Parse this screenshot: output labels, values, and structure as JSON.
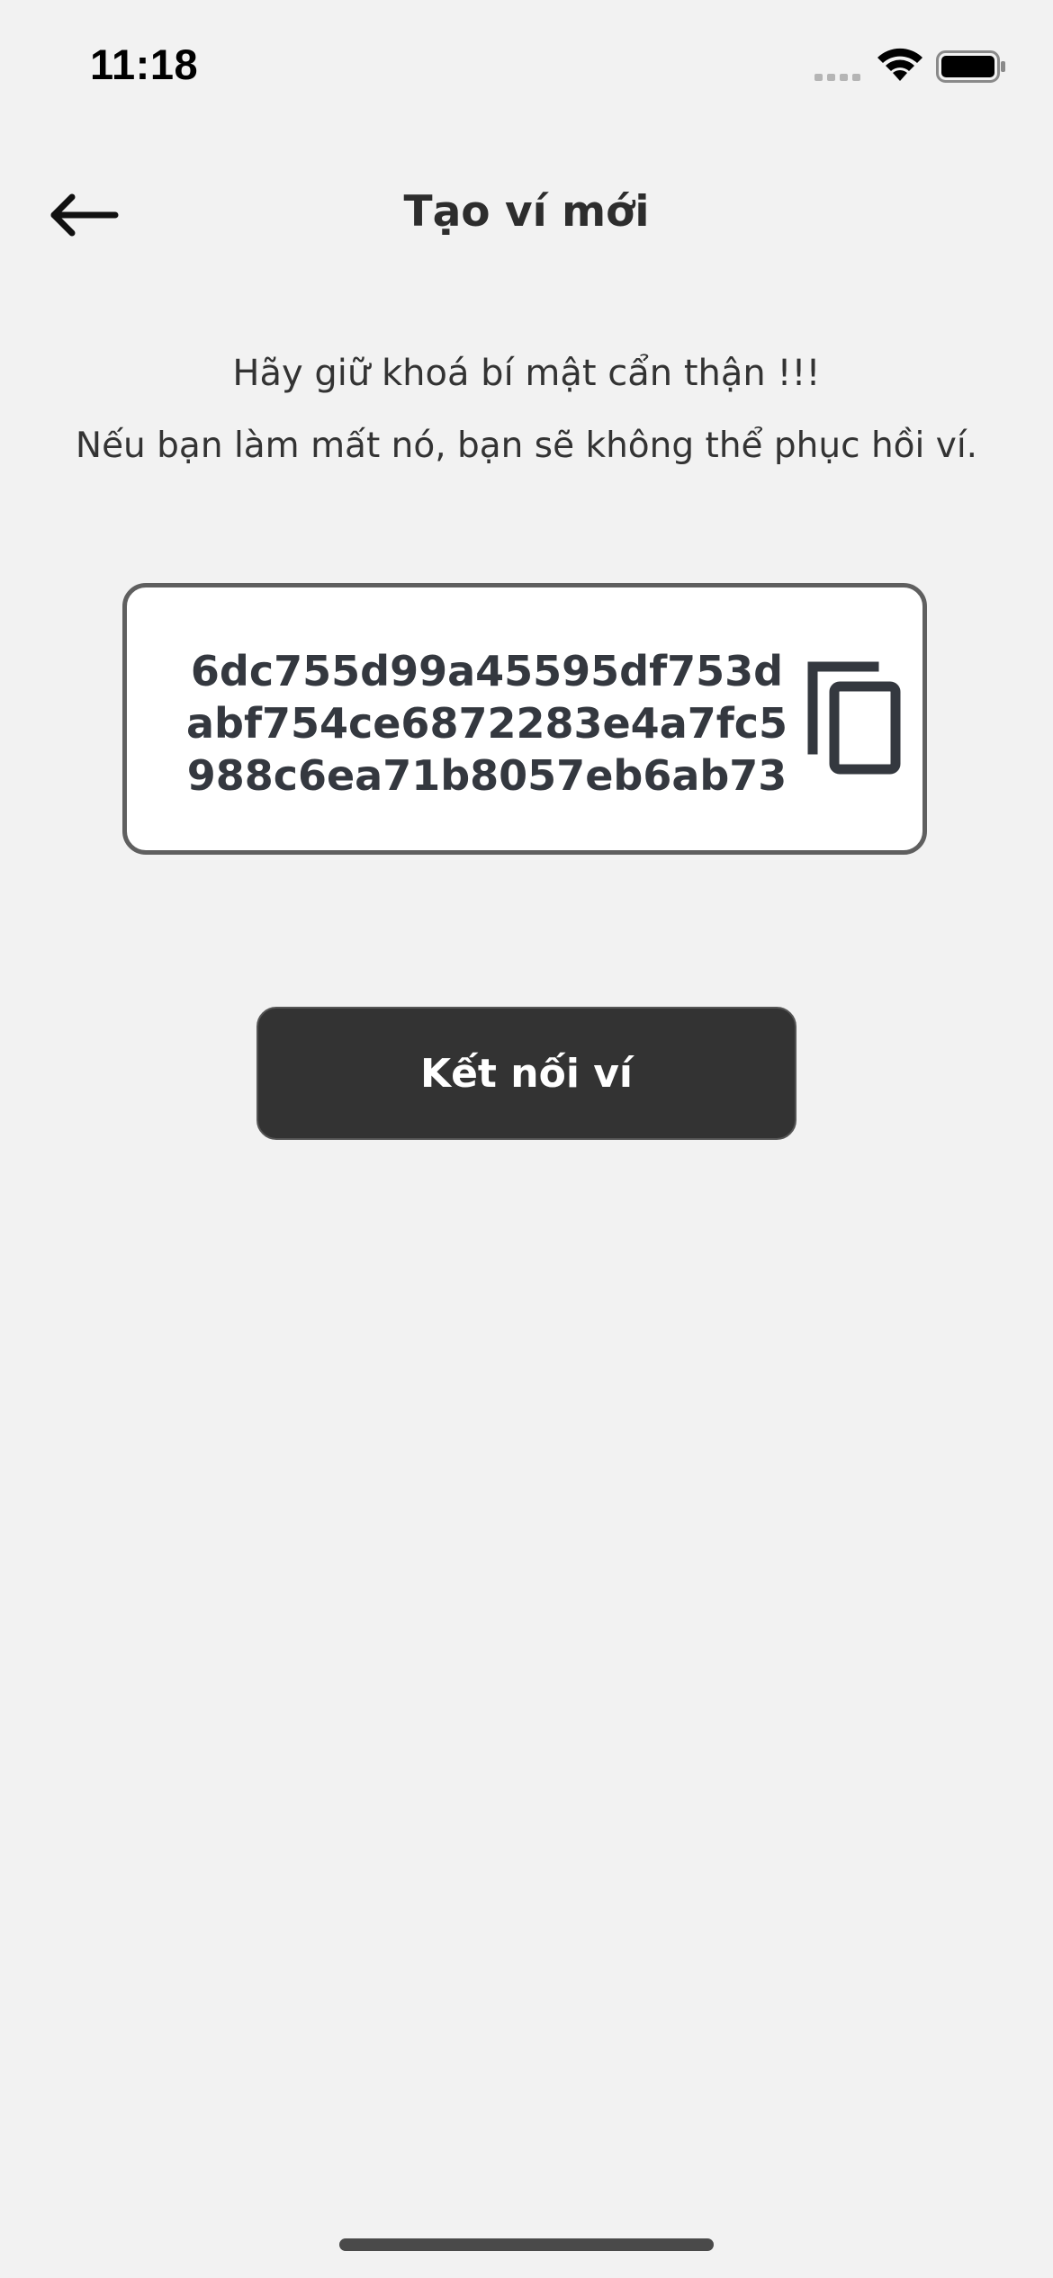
{
  "status_bar": {
    "time": "11:18"
  },
  "header": {
    "title": "Tạo ví mới",
    "back_icon": "arrow-left-icon"
  },
  "warning": {
    "line1": "Hãy giữ khoá bí mật cẩn thận !!!",
    "line2": "Nếu bạn làm mất nó, bạn sẽ không thể phục hồi ví."
  },
  "private_key": {
    "value": "6dc755d99a45595df753dabf754ce6872283e4a7fc5988c6ea71b8057eb6ab73",
    "copy_icon": "copy-icon"
  },
  "actions": {
    "connect_label": "Kết nối ví"
  },
  "colors": {
    "background": "#f2f2f2",
    "button": "#333333",
    "key_text": "#34383f",
    "box_border": "#5f5f5f"
  }
}
